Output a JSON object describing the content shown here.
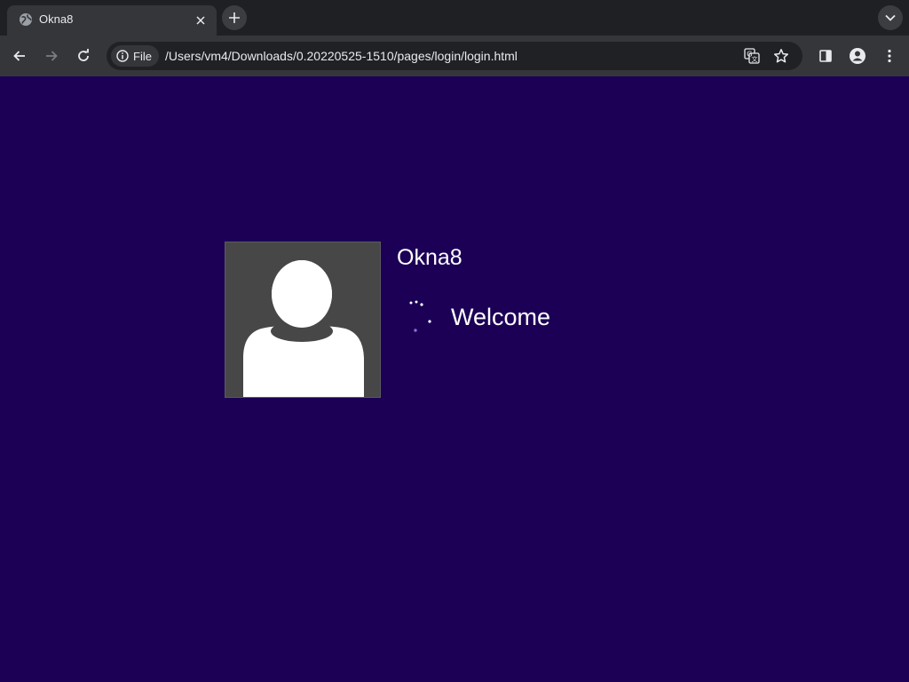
{
  "browser": {
    "tab": {
      "title": "Okna8",
      "favicon": "globe-icon"
    },
    "toolbar": {
      "site_chip_label": "File",
      "url": "/Users/vm4/Downloads/0.20220525-1510/pages/login/login.html"
    },
    "colors": {
      "tabstrip_bg": "#1f2023",
      "toolbar_bg": "#35363a",
      "omnibox_bg": "#202124"
    }
  },
  "page": {
    "background": "#1b0056",
    "login": {
      "username": "Okna8",
      "status": "Welcome",
      "avatar": "user-silhouette-icon",
      "spinner": "loading-spinner-icon"
    }
  }
}
